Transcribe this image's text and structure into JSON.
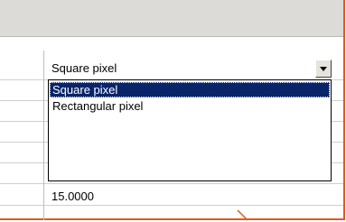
{
  "combo": {
    "selected_value": "Square pixel"
  },
  "dropdown": {
    "options": [
      {
        "label": "Square pixel",
        "selected": true
      },
      {
        "label": "Rectangular pixel",
        "selected": false
      }
    ]
  },
  "cells": {
    "numeric_value": "15.0000"
  },
  "colors": {
    "highlight": "#0a246a",
    "frame_accent": "#e05a1e",
    "header_band": "#dcdbd7"
  }
}
